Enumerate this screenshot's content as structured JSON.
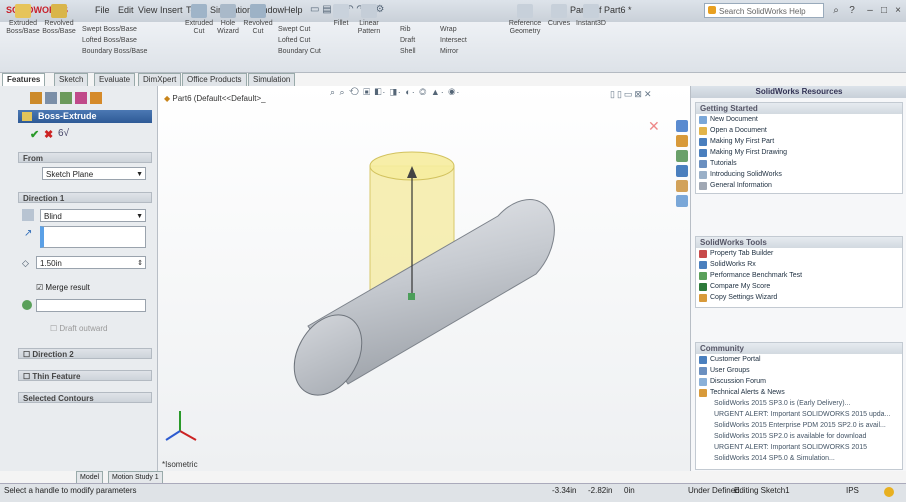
{
  "app": {
    "logo_text": "SOLIDWORKS",
    "doc_title": "Part6 of Part6 *"
  },
  "menu": [
    "File",
    "Edit",
    "View",
    "Insert",
    "Tools",
    "Simulation",
    "Window",
    "Help"
  ],
  "search": {
    "placeholder": "Search SolidWorks Help"
  },
  "toolbar": {
    "big": [
      {
        "label": "Extruded Boss/Base"
      },
      {
        "label": "Revolved Boss/Base"
      },
      {
        "label": "Extruded Cut"
      },
      {
        "label": "Hole Wizard"
      },
      {
        "label": "Revolved Cut"
      },
      {
        "label": "Fillet"
      },
      {
        "label": "Linear Pattern"
      },
      {
        "label": "Reference Geometry"
      },
      {
        "label": "Curves"
      },
      {
        "label": "Instant3D"
      }
    ],
    "small": [
      "Swept Boss/Base",
      "Lofted Boss/Base",
      "Boundary Boss/Base",
      "Swept Cut",
      "Lofted Cut",
      "Boundary Cut",
      "Rib",
      "Wrap",
      "Draft",
      "Intersect",
      "Shell",
      "Mirror"
    ]
  },
  "tabs": [
    "Features",
    "Sketch",
    "Evaluate",
    "DimXpert",
    "Office Products",
    "Simulation"
  ],
  "feature_tree": {
    "part_label": "Part6 (Default<<Default>_"
  },
  "pm": {
    "title": "Boss-Extrude",
    "from_head": "From",
    "from_value": "Sketch Plane",
    "dir1_head": "Direction 1",
    "end_cond": "Blind",
    "depth": "1.50in",
    "merge": "Merge result",
    "draft": "Draft outward",
    "dir2_head": "Direction 2",
    "thin_head": "Thin Feature",
    "contours_head": "Selected Contours"
  },
  "view": {
    "orientation": "*Isometric"
  },
  "taskpane": {
    "title": "SolidWorks Resources",
    "getting_started": {
      "head": "Getting Started",
      "items": [
        "New Document",
        "Open a Document",
        "Making My First Part",
        "Making My First Drawing",
        "Tutorials",
        "Introducing SolidWorks",
        "General Information"
      ]
    },
    "tools": {
      "head": "SolidWorks Tools",
      "items": [
        "Property Tab Builder",
        "SolidWorks Rx",
        "Performance Benchmark Test",
        "Compare My Score",
        "Copy Settings Wizard"
      ]
    },
    "community": {
      "head": "Community",
      "items": [
        "Customer Portal",
        "User Groups",
        "Discussion Forum",
        "Technical Alerts & News"
      ],
      "news": [
        "SolidWorks 2015 SP3.0 is (Early Delivery)...",
        "URGENT ALERT: Important SOLIDWORKS 2015 upda...",
        "SolidWorks 2015 Enterprise PDM 2015 SP2.0 is avail...",
        "SolidWorks 2015 SP2.0 is available for download",
        "URGENT ALERT: Important SOLIDWORKS 2015",
        "SolidWorks 2014 SP5.0 & Simulation..."
      ]
    }
  },
  "bottom_tabs": [
    "Model",
    "Motion Study 1"
  ],
  "status": {
    "hint": "Select a handle to modify parameters",
    "coord1": "-3.34in",
    "coord2": "-2.82in",
    "coord3": "0in",
    "state": "Under Defined",
    "mode": "Editing Sketch1",
    "units": "IPS"
  },
  "colors": {
    "cylinder": "#c8ccd2",
    "preview": "#f2e48a",
    "accent": "#2d6bb8"
  }
}
